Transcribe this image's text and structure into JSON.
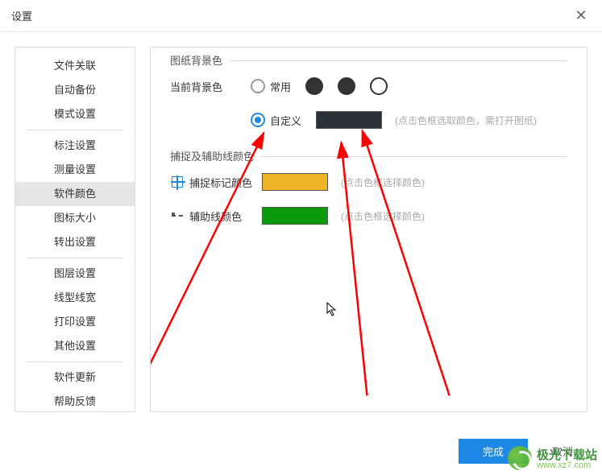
{
  "window": {
    "title": "设置"
  },
  "sidebar": {
    "items": [
      {
        "label": "文件关联"
      },
      {
        "label": "自动备份"
      },
      {
        "label": "模式设置"
      },
      {
        "label": "标注设置"
      },
      {
        "label": "测量设置"
      },
      {
        "label": "软件颜色"
      },
      {
        "label": "图标大小"
      },
      {
        "label": "转出设置"
      },
      {
        "label": "图层设置"
      },
      {
        "label": "线型线宽"
      },
      {
        "label": "打印设置"
      },
      {
        "label": "其他设置"
      },
      {
        "label": "软件更新"
      },
      {
        "label": "帮助反馈"
      }
    ],
    "selected_index": 5
  },
  "page": {
    "group_bg": {
      "title": "图纸背景色",
      "label_current": "当前背景色",
      "option_common": "常用",
      "option_custom": "自定义",
      "custom_color": "#2b3138",
      "hint_custom": "(点击色框选取颜色，需打开图纸)"
    },
    "group_snap": {
      "title": "捕捉及辅助线颜色",
      "label_mark": "捕捉标记颜色",
      "mark_color": "#f0b428",
      "hint_mark": "(点击色框选择颜色)",
      "label_aux": "辅助线颜色",
      "aux_color": "#0a9a0a",
      "hint_aux": "(点击色框选择颜色)"
    }
  },
  "footer": {
    "ok": "完成",
    "cancel": "取消"
  },
  "watermark": {
    "name": "极光下载站",
    "url": "www.xz7.com"
  }
}
